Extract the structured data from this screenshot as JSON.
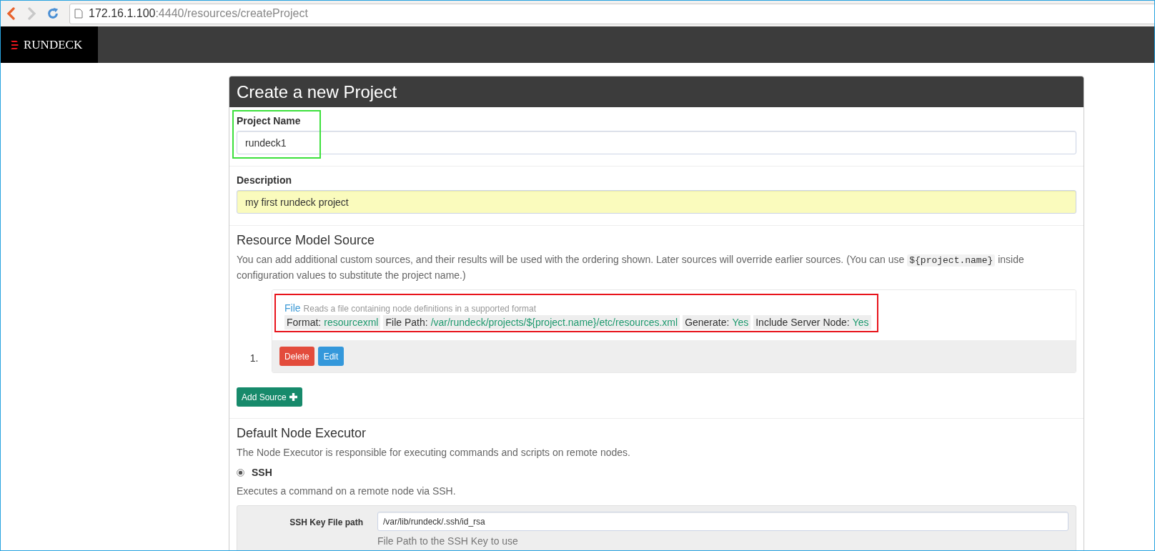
{
  "browser": {
    "url_host": "172.16.1.100",
    "url_path": ":4440/resources/createProject"
  },
  "navbar": {
    "brand": "RUNDECK"
  },
  "panel": {
    "title": "Create a new Project",
    "fields": [
      {
        "label": "Project Name",
        "value": "rundeck1",
        "highlighted": true,
        "autofilled": false
      },
      {
        "label": "Description",
        "value": "my first rundeck project",
        "highlighted": false,
        "autofilled": true
      }
    ],
    "resource_model": {
      "heading": "Resource Model Source",
      "description_before": "You can add additional custom sources, and their results will be used with the ordering shown. Later sources will override earlier sources. (You can use ",
      "description_code": "${project.name}",
      "description_after": " inside configuration values to substitute the project name.)",
      "sources": [
        {
          "number": "1.",
          "title": "File",
          "summary": "Reads a file containing node definitions in a supported format",
          "highlighted": true,
          "properties": [
            {
              "key": "Format:",
              "value": "resourcexml"
            },
            {
              "key": "File Path:",
              "value": "/var/rundeck/projects/${project.name}/etc/resources.xml"
            },
            {
              "key": "Generate:",
              "value": "Yes"
            },
            {
              "key": "Include Server Node:",
              "value": "Yes"
            }
          ],
          "buttons": [
            {
              "label": "Delete",
              "kind": "danger"
            },
            {
              "label": "Edit",
              "kind": "info"
            }
          ]
        }
      ],
      "add_button": "Add Source"
    },
    "node_executor": {
      "heading": "Default Node Executor",
      "description": "The Node Executor is responsible for executing commands and scripts on remote nodes.",
      "options": [
        {
          "label": "SSH",
          "selected": true,
          "description": "Executes a command on a remote node via SSH."
        }
      ],
      "settings": [
        {
          "label": "SSH Key File path",
          "value": "/var/lib/rundeck/.ssh/id_rsa",
          "help": "File Path to the SSH Key to use"
        }
      ]
    }
  }
}
